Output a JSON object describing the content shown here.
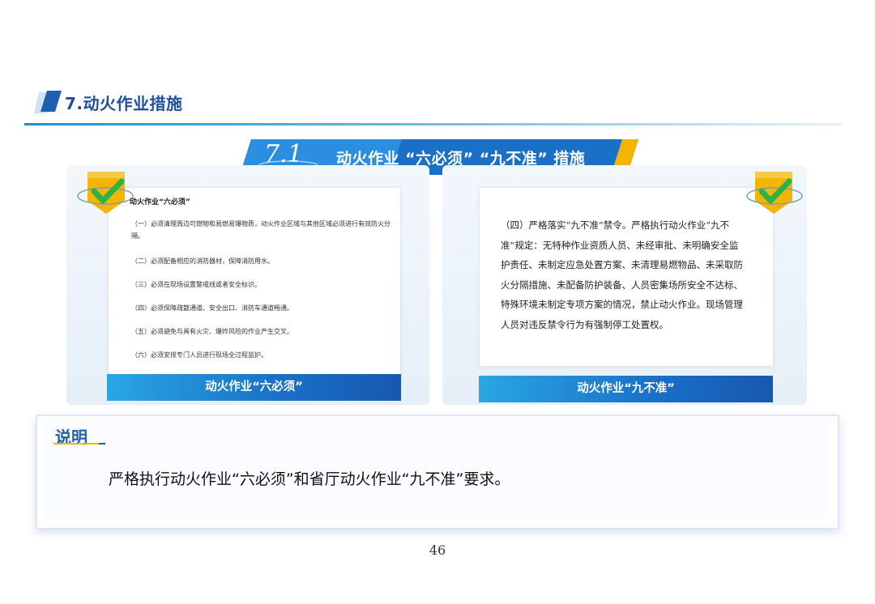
{
  "section": {
    "title": "7.动火作业措施"
  },
  "banner": {
    "number": "7.1",
    "title": "动火作业 “六必须” “九不准” 措施"
  },
  "left_panel": {
    "heading": "动火作业“六必须”",
    "items": [
      "（一）必须清理周边可燃物和易燃易爆物质，动火作业区域与其他区域必须进行有效防火分隔。",
      "（二）必须配备相应的消防器材，保障消防用水。",
      "（三）必须在现场设置警戒线或者安全标识。",
      "（四）必须保障疏散通道、安全出口、消防车通道畅通。",
      "（五）必须避免与具有火灾、爆炸风险的作业产生交叉。",
      "（六）必须安排专门人员进行现场全过程监护。"
    ],
    "caption": "动火作业“六必须”"
  },
  "right_panel": {
    "paragraph": "（四）严格落实“九不准”禁令。严格执行动火作业“九不准”规定：无特种作业资质人员、未经审批、未明确安全监护责任、未制定应急处置方案、未清理易燃物品、未采取防火分隔措施、未配备防护装备、人员密集场所安全不达标、特殊环境未制定专项方案的情况，禁止动火作业。现场管理人员对违反禁令行为有强制停工处置权。",
    "caption": "动火作业“九不准”"
  },
  "note": {
    "label": "说明",
    "text": "严格执行动火作业“六必须”和省厅动火作业“九不准”要求。"
  },
  "page_number": "46",
  "colors": {
    "accent_blue": "#1f5fb0",
    "banner_blue": "#1a6fc7",
    "check_green": "#2fb14a",
    "badge_gold": "#f4b400"
  },
  "icons": [
    "check-badge-icon",
    "section-tab-icon"
  ]
}
